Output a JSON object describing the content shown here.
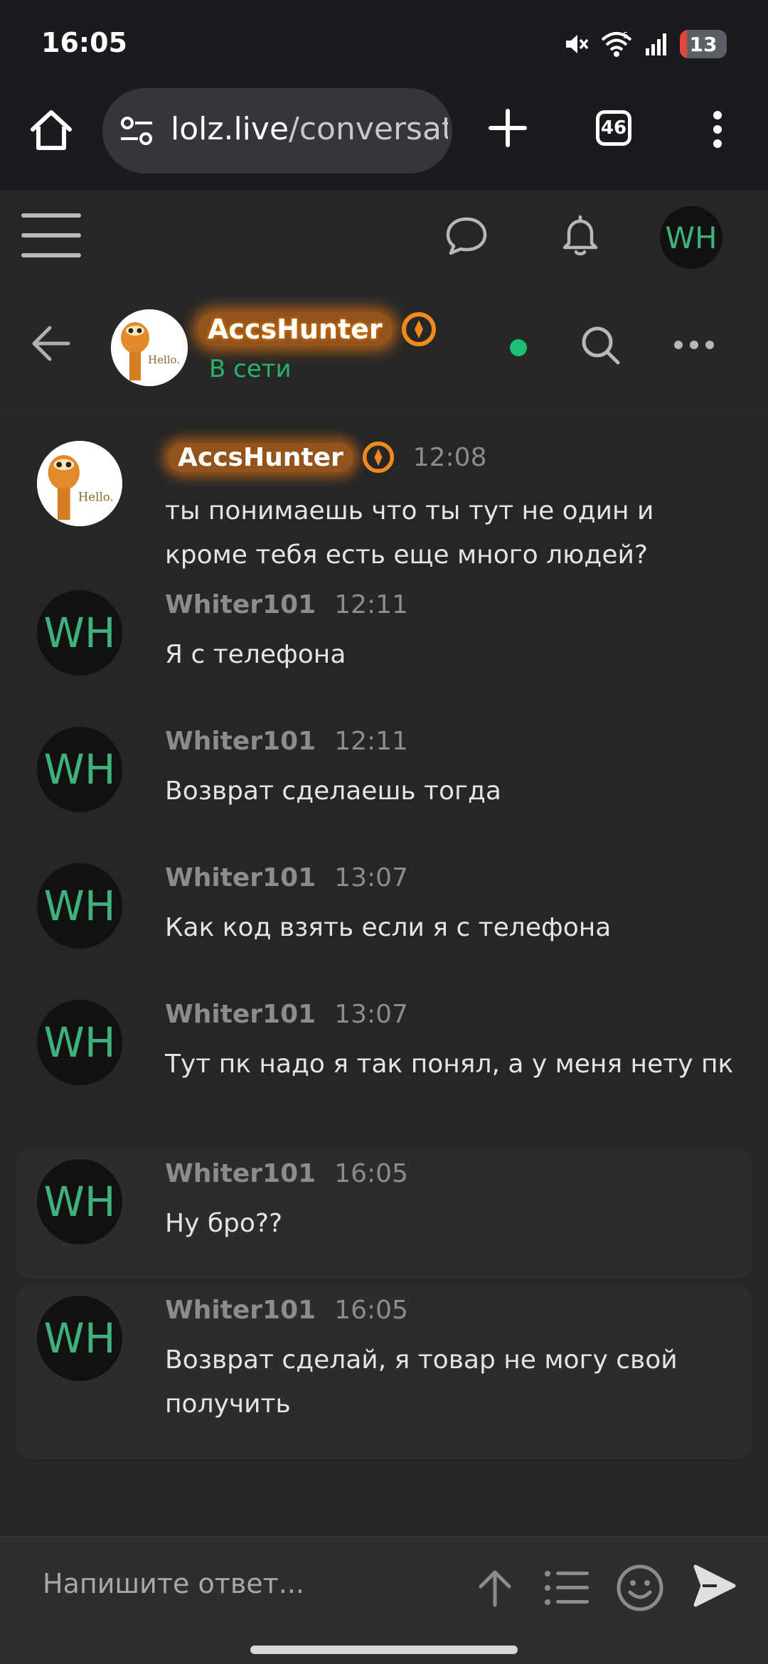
{
  "status_bar": {
    "time": "16:05",
    "battery": "13",
    "icons": [
      "mute-icon",
      "wifi-icon",
      "signal-icon",
      "battery-icon"
    ]
  },
  "browser": {
    "url_domain": "lolz.live",
    "url_path": "/conversat",
    "tab_count": "46"
  },
  "site_header": {
    "avatar_initials": "WH"
  },
  "conversation": {
    "partner_name": "AccsHunter",
    "partner_status": "В сети",
    "accent_color": "#27b46e",
    "name_glow_color": "#ec7814"
  },
  "messages": [
    {
      "author": "AccsHunter",
      "time": "12:08",
      "text": "ты понимаешь что ты тут не один и кроме тебя есть еще много людей?",
      "avatar": "garfield-hello"
    },
    {
      "author": "Whiter101",
      "time": "12:11",
      "text": "Я с телефона",
      "avatar_initials": "WH"
    },
    {
      "author": "Whiter101",
      "time": "12:11",
      "text": "Возврат сделаешь тогда",
      "avatar_initials": "WH"
    },
    {
      "author": "Whiter101",
      "time": "13:07",
      "text": "Как код взять если я с телефона",
      "avatar_initials": "WH"
    },
    {
      "author": "Whiter101",
      "time": "13:07",
      "text": "Тут пк надо я так понял, а у меня нету пк",
      "avatar_initials": "WH"
    },
    {
      "author": "Whiter101",
      "time": "16:05",
      "text": "Ну бро??",
      "avatar_initials": "WH",
      "unread": true
    },
    {
      "author": "Whiter101",
      "time": "16:05",
      "text": "Возврат сделай, я товар не могу свой получить",
      "avatar_initials": "WH",
      "unread": true
    }
  ],
  "composer": {
    "placeholder": "Напишите ответ..."
  },
  "avatar_caption": "Hello."
}
